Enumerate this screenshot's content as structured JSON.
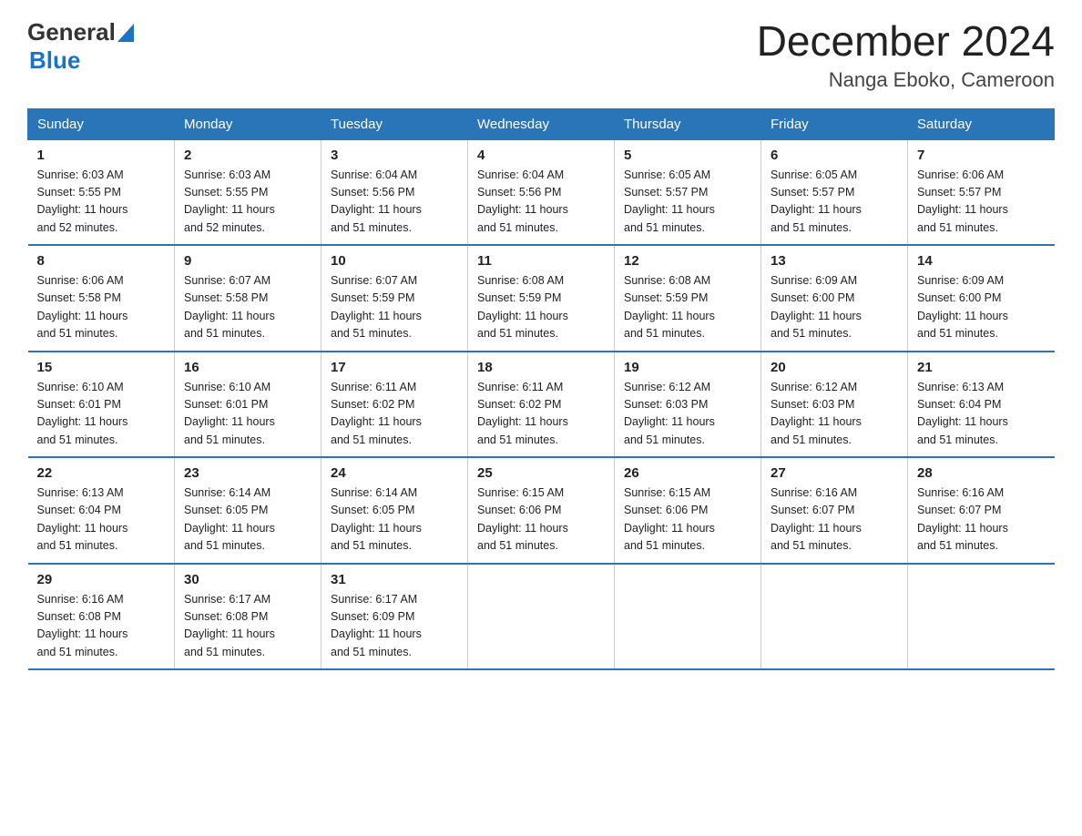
{
  "logo": {
    "general": "General",
    "blue": "Blue"
  },
  "title": "December 2024",
  "subtitle": "Nanga Eboko, Cameroon",
  "weekdays": [
    "Sunday",
    "Monday",
    "Tuesday",
    "Wednesday",
    "Thursday",
    "Friday",
    "Saturday"
  ],
  "weeks": [
    [
      {
        "day": "1",
        "info": "Sunrise: 6:03 AM\nSunset: 5:55 PM\nDaylight: 11 hours\nand 52 minutes."
      },
      {
        "day": "2",
        "info": "Sunrise: 6:03 AM\nSunset: 5:55 PM\nDaylight: 11 hours\nand 52 minutes."
      },
      {
        "day": "3",
        "info": "Sunrise: 6:04 AM\nSunset: 5:56 PM\nDaylight: 11 hours\nand 51 minutes."
      },
      {
        "day": "4",
        "info": "Sunrise: 6:04 AM\nSunset: 5:56 PM\nDaylight: 11 hours\nand 51 minutes."
      },
      {
        "day": "5",
        "info": "Sunrise: 6:05 AM\nSunset: 5:57 PM\nDaylight: 11 hours\nand 51 minutes."
      },
      {
        "day": "6",
        "info": "Sunrise: 6:05 AM\nSunset: 5:57 PM\nDaylight: 11 hours\nand 51 minutes."
      },
      {
        "day": "7",
        "info": "Sunrise: 6:06 AM\nSunset: 5:57 PM\nDaylight: 11 hours\nand 51 minutes."
      }
    ],
    [
      {
        "day": "8",
        "info": "Sunrise: 6:06 AM\nSunset: 5:58 PM\nDaylight: 11 hours\nand 51 minutes."
      },
      {
        "day": "9",
        "info": "Sunrise: 6:07 AM\nSunset: 5:58 PM\nDaylight: 11 hours\nand 51 minutes."
      },
      {
        "day": "10",
        "info": "Sunrise: 6:07 AM\nSunset: 5:59 PM\nDaylight: 11 hours\nand 51 minutes."
      },
      {
        "day": "11",
        "info": "Sunrise: 6:08 AM\nSunset: 5:59 PM\nDaylight: 11 hours\nand 51 minutes."
      },
      {
        "day": "12",
        "info": "Sunrise: 6:08 AM\nSunset: 5:59 PM\nDaylight: 11 hours\nand 51 minutes."
      },
      {
        "day": "13",
        "info": "Sunrise: 6:09 AM\nSunset: 6:00 PM\nDaylight: 11 hours\nand 51 minutes."
      },
      {
        "day": "14",
        "info": "Sunrise: 6:09 AM\nSunset: 6:00 PM\nDaylight: 11 hours\nand 51 minutes."
      }
    ],
    [
      {
        "day": "15",
        "info": "Sunrise: 6:10 AM\nSunset: 6:01 PM\nDaylight: 11 hours\nand 51 minutes."
      },
      {
        "day": "16",
        "info": "Sunrise: 6:10 AM\nSunset: 6:01 PM\nDaylight: 11 hours\nand 51 minutes."
      },
      {
        "day": "17",
        "info": "Sunrise: 6:11 AM\nSunset: 6:02 PM\nDaylight: 11 hours\nand 51 minutes."
      },
      {
        "day": "18",
        "info": "Sunrise: 6:11 AM\nSunset: 6:02 PM\nDaylight: 11 hours\nand 51 minutes."
      },
      {
        "day": "19",
        "info": "Sunrise: 6:12 AM\nSunset: 6:03 PM\nDaylight: 11 hours\nand 51 minutes."
      },
      {
        "day": "20",
        "info": "Sunrise: 6:12 AM\nSunset: 6:03 PM\nDaylight: 11 hours\nand 51 minutes."
      },
      {
        "day": "21",
        "info": "Sunrise: 6:13 AM\nSunset: 6:04 PM\nDaylight: 11 hours\nand 51 minutes."
      }
    ],
    [
      {
        "day": "22",
        "info": "Sunrise: 6:13 AM\nSunset: 6:04 PM\nDaylight: 11 hours\nand 51 minutes."
      },
      {
        "day": "23",
        "info": "Sunrise: 6:14 AM\nSunset: 6:05 PM\nDaylight: 11 hours\nand 51 minutes."
      },
      {
        "day": "24",
        "info": "Sunrise: 6:14 AM\nSunset: 6:05 PM\nDaylight: 11 hours\nand 51 minutes."
      },
      {
        "day": "25",
        "info": "Sunrise: 6:15 AM\nSunset: 6:06 PM\nDaylight: 11 hours\nand 51 minutes."
      },
      {
        "day": "26",
        "info": "Sunrise: 6:15 AM\nSunset: 6:06 PM\nDaylight: 11 hours\nand 51 minutes."
      },
      {
        "day": "27",
        "info": "Sunrise: 6:16 AM\nSunset: 6:07 PM\nDaylight: 11 hours\nand 51 minutes."
      },
      {
        "day": "28",
        "info": "Sunrise: 6:16 AM\nSunset: 6:07 PM\nDaylight: 11 hours\nand 51 minutes."
      }
    ],
    [
      {
        "day": "29",
        "info": "Sunrise: 6:16 AM\nSunset: 6:08 PM\nDaylight: 11 hours\nand 51 minutes."
      },
      {
        "day": "30",
        "info": "Sunrise: 6:17 AM\nSunset: 6:08 PM\nDaylight: 11 hours\nand 51 minutes."
      },
      {
        "day": "31",
        "info": "Sunrise: 6:17 AM\nSunset: 6:09 PM\nDaylight: 11 hours\nand 51 minutes."
      },
      {
        "day": "",
        "info": ""
      },
      {
        "day": "",
        "info": ""
      },
      {
        "day": "",
        "info": ""
      },
      {
        "day": "",
        "info": ""
      }
    ]
  ]
}
